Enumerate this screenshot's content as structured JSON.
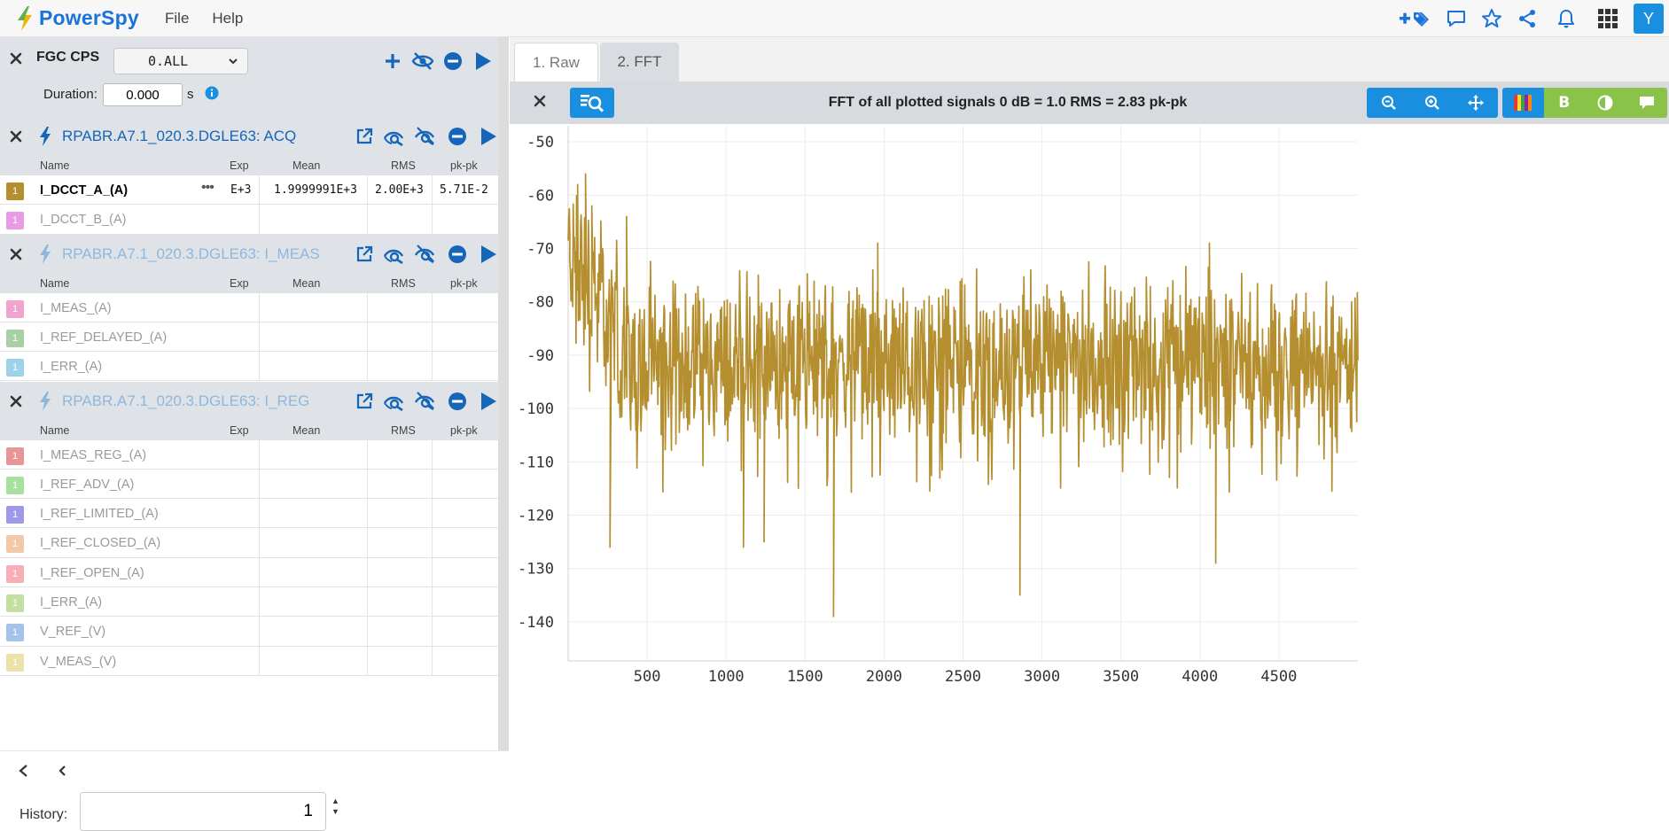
{
  "app": {
    "name": "PowerSpy",
    "menu": [
      "File",
      "Help"
    ],
    "user_initial": "Y"
  },
  "top_icons": [
    "add-tags-icon",
    "comment-icon",
    "star-icon",
    "share-icon",
    "bell-icon",
    "apps-grid-icon"
  ],
  "source": {
    "title": "FGC CPS",
    "selector_value": "0.ALL",
    "duration_label": "Duration:",
    "duration_value": "0.000",
    "duration_unit": "s"
  },
  "columns": {
    "name": "Name",
    "exp": "Exp",
    "mean": "Mean",
    "rms": "RMS",
    "pkpk": "pk-pk"
  },
  "groups": [
    {
      "title": "RPABR.A7.1_020.3.DGLE63: ACQ",
      "active": true,
      "signals": [
        {
          "name": "I_DCCT_A_(A)",
          "badge": "1",
          "color": "#b58f2f",
          "active": true,
          "exp": "E+3",
          "mean": "1.9999991E+3",
          "rms": "2.00E+3",
          "pkpk": "5.71E-2"
        },
        {
          "name": "I_DCCT_B_(A)",
          "badge": "1",
          "color": "#e99be5",
          "active": false
        }
      ]
    },
    {
      "title": "RPABR.A7.1_020.3.DGLE63: I_MEAS",
      "active": false,
      "signals": [
        {
          "name": "I_MEAS_(A)",
          "badge": "1",
          "color": "#f2a2ce",
          "active": false
        },
        {
          "name": "I_REF_DELAYED_(A)",
          "badge": "1",
          "color": "#a9cfa5",
          "active": false
        },
        {
          "name": "I_ERR_(A)",
          "badge": "1",
          "color": "#9dd2ea",
          "active": false
        }
      ]
    },
    {
      "title": "RPABR.A7.1_020.3.DGLE63: I_REG",
      "active": false,
      "signals": [
        {
          "name": "I_MEAS_REG_(A)",
          "badge": "1",
          "color": "#e99596",
          "active": false
        },
        {
          "name": "I_REF_ADV_(A)",
          "badge": "1",
          "color": "#a8e0a0",
          "active": false
        },
        {
          "name": "I_REF_LIMITED_(A)",
          "badge": "1",
          "color": "#9d99e8",
          "active": false
        },
        {
          "name": "I_REF_CLOSED_(A)",
          "badge": "1",
          "color": "#f1c9a8",
          "active": false
        },
        {
          "name": "I_REF_OPEN_(A)",
          "badge": "1",
          "color": "#f7aeb7",
          "active": false
        },
        {
          "name": "I_ERR_(A)",
          "badge": "1",
          "color": "#c3dfa1",
          "active": false
        },
        {
          "name": "V_REF_(V)",
          "badge": "1",
          "color": "#a6c1ea",
          "active": false
        },
        {
          "name": "V_MEAS_(V)",
          "badge": "1",
          "color": "#ece1a7",
          "active": false
        }
      ]
    }
  ],
  "history": {
    "label": "History:",
    "value": "1"
  },
  "tabs": [
    "1. Raw",
    "2. FFT"
  ],
  "plot": {
    "title": "FFT of all plotted signals 0 dB = 1.0 RMS = 2.83 pk-pk",
    "bold_label": "B"
  },
  "chart_data": {
    "type": "line",
    "title": "",
    "xlabel": "",
    "ylabel": "",
    "xlim": [
      0,
      5000
    ],
    "ylim": [
      -145,
      -47
    ],
    "x_ticks": [
      500,
      1000,
      1500,
      2000,
      2500,
      3000,
      3500,
      4000,
      4500
    ],
    "y_ticks": [
      -50,
      -60,
      -70,
      -80,
      -90,
      -100,
      -110,
      -120,
      -130,
      -140
    ],
    "grid": true,
    "series": [
      {
        "color": "#b58f2f",
        "description_of_shape": "dense noisy spectrum; rises to about -56 dB near x=100, mostly oscillates between -80 and -105 dB across the full range",
        "x_range": [
          0,
          5000
        ],
        "baseline": -92,
        "notable_points": [
          {
            "x": 10,
            "y": -72
          },
          {
            "x": 60,
            "y": -58
          },
          {
            "x": 110,
            "y": -56
          },
          {
            "x": 150,
            "y": -62
          },
          {
            "x": 265,
            "y": -126
          },
          {
            "x": 370,
            "y": -64
          },
          {
            "x": 1110,
            "y": -126
          },
          {
            "x": 1240,
            "y": -125
          },
          {
            "x": 1680,
            "y": -139
          },
          {
            "x": 1960,
            "y": -69
          },
          {
            "x": 2860,
            "y": -135
          },
          {
            "x": 4060,
            "y": -69
          },
          {
            "x": 4100,
            "y": -129
          },
          {
            "x": 4960,
            "y": -80
          }
        ]
      }
    ]
  }
}
